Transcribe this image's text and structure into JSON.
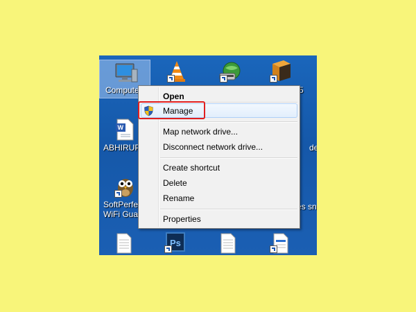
{
  "desktop": {
    "labels": {
      "computer": "Compute",
      "doc1": "ABHIRUP",
      "owl_line1": "SoftPerfe",
      "owl_line2": "WiFi Gua",
      "right_top": "5",
      "right_mid": "de",
      "right_low": "es sn"
    }
  },
  "context_menu": {
    "items": [
      {
        "label": "Open",
        "bold": true
      },
      {
        "label": "Manage",
        "icon": "shield-icon"
      },
      {
        "label": "Map network drive..."
      },
      {
        "label": "Disconnect network drive..."
      },
      {
        "label": "Create shortcut"
      },
      {
        "label": "Delete"
      },
      {
        "label": "Rename"
      },
      {
        "label": "Properties"
      }
    ]
  },
  "colors": {
    "page_background": "#f8f57a",
    "desktop_blue": "#1a5fb1",
    "highlight_red": "#e01f1f"
  }
}
